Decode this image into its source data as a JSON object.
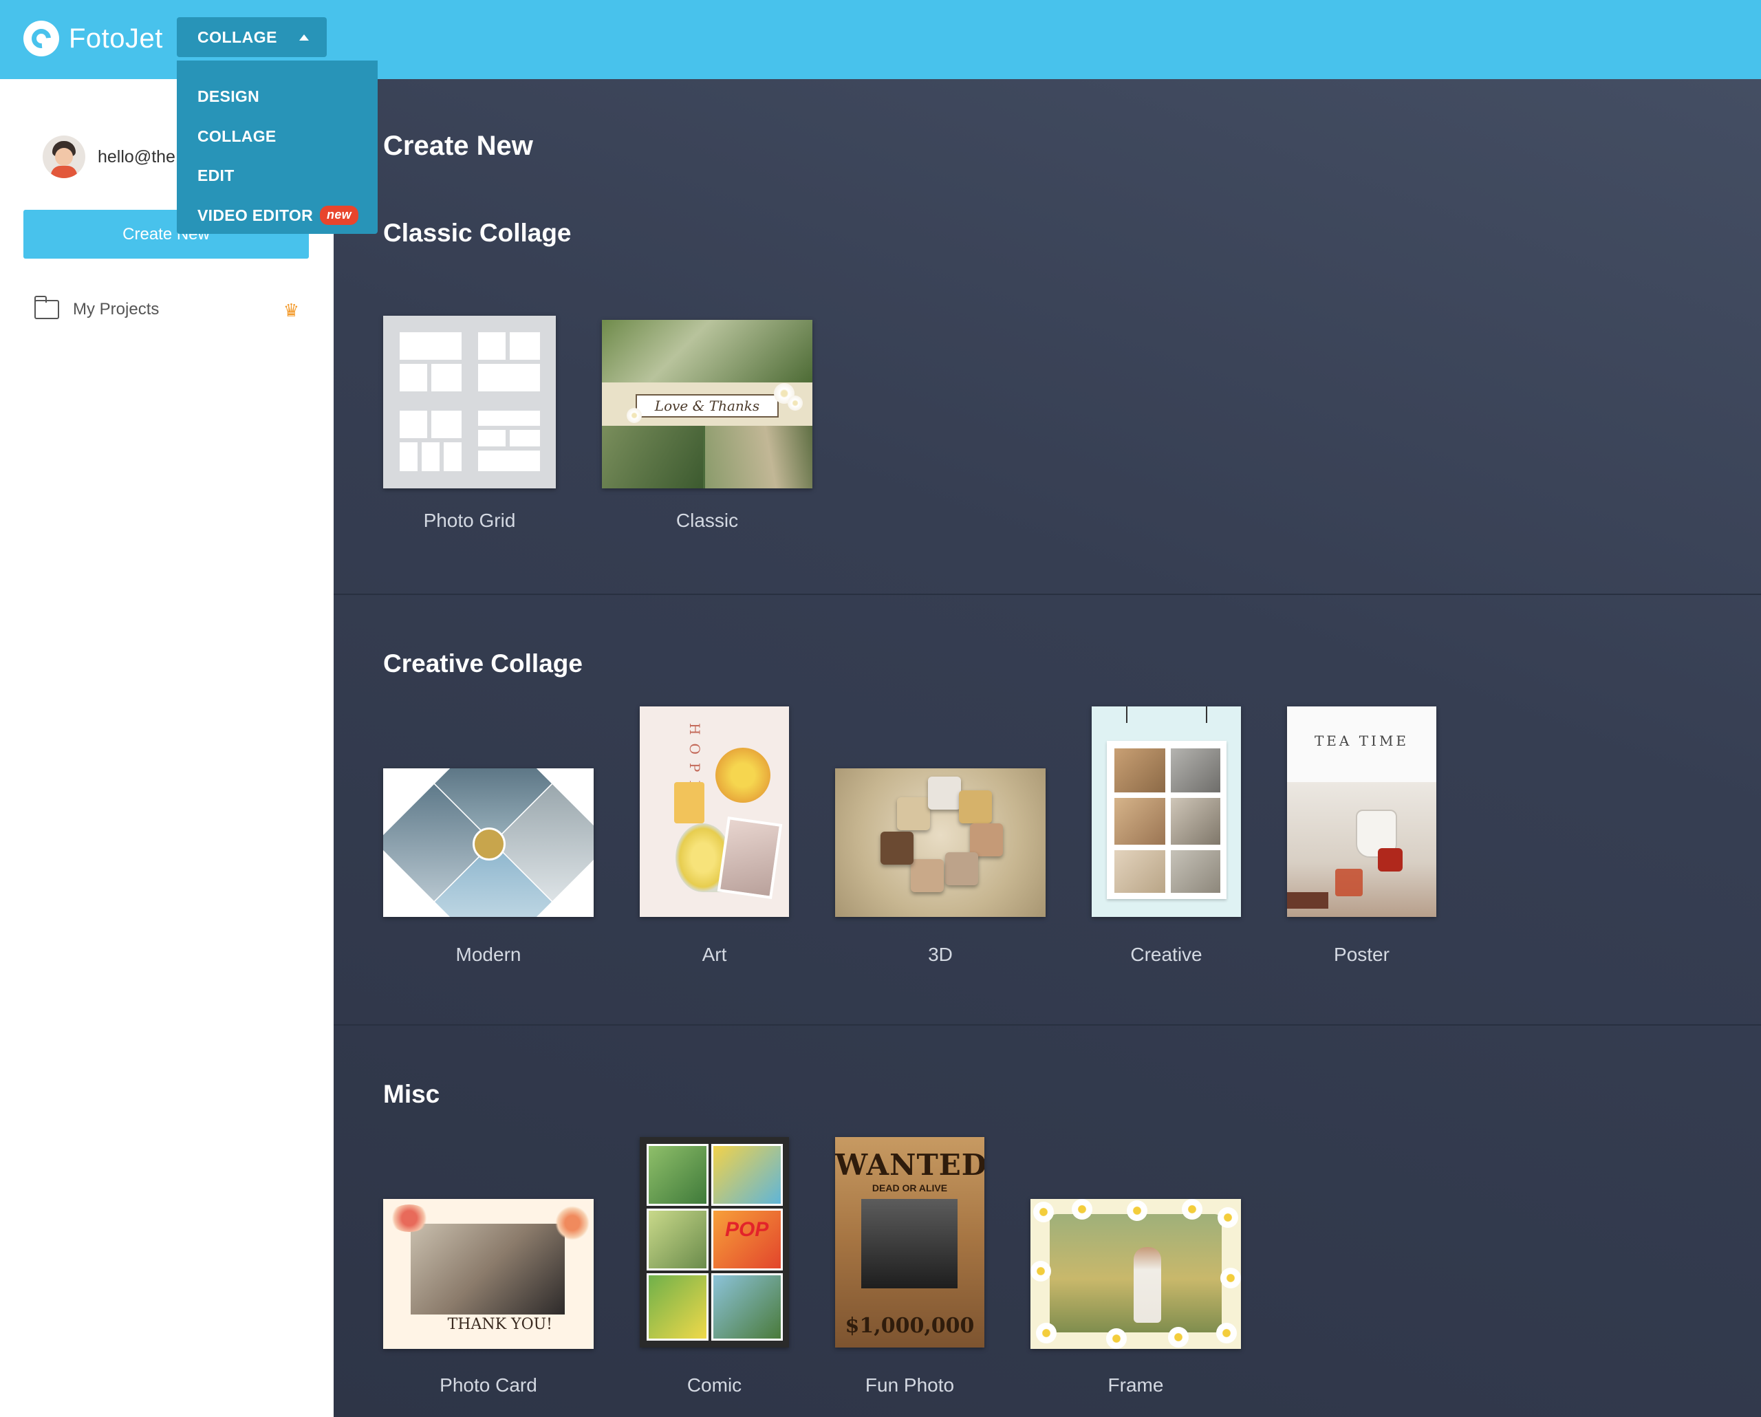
{
  "app": {
    "logo_text": "FotoJet",
    "brand_color": "#48c2ec",
    "mode_button": "COLLAGE",
    "mode_menu": {
      "items": [
        {
          "label": "DESIGN"
        },
        {
          "label": "COLLAGE"
        },
        {
          "label": "EDIT"
        },
        {
          "label": "VIDEO EDITOR",
          "badge": "new"
        }
      ]
    }
  },
  "sidebar": {
    "user_email": "hello@the",
    "create_new": "Create New",
    "my_projects": "My Projects",
    "crown_icon": "crown-icon"
  },
  "main": {
    "heading": "Create New",
    "sections": [
      {
        "title": "Classic Collage",
        "items": [
          {
            "label": "Photo Grid"
          },
          {
            "label": "Classic",
            "thumb_text": "Love & Thanks"
          }
        ]
      },
      {
        "title": "Creative Collage",
        "items": [
          {
            "label": "Modern"
          },
          {
            "label": "Art",
            "thumb_text": "HOPE"
          },
          {
            "label": "3D"
          },
          {
            "label": "Creative"
          },
          {
            "label": "Poster",
            "thumb_text": "TEA TIME"
          }
        ]
      },
      {
        "title": "Misc",
        "items": [
          {
            "label": "Photo Card",
            "thumb_text": "THANK YOU!"
          },
          {
            "label": "Comic",
            "thumb_text": "POP"
          },
          {
            "label": "Fun Photo",
            "thumb_text": "WANTED",
            "thumb_sub": "DEAD OR ALIVE",
            "thumb_money": "$1,000,000"
          },
          {
            "label": "Frame"
          }
        ]
      }
    ]
  }
}
